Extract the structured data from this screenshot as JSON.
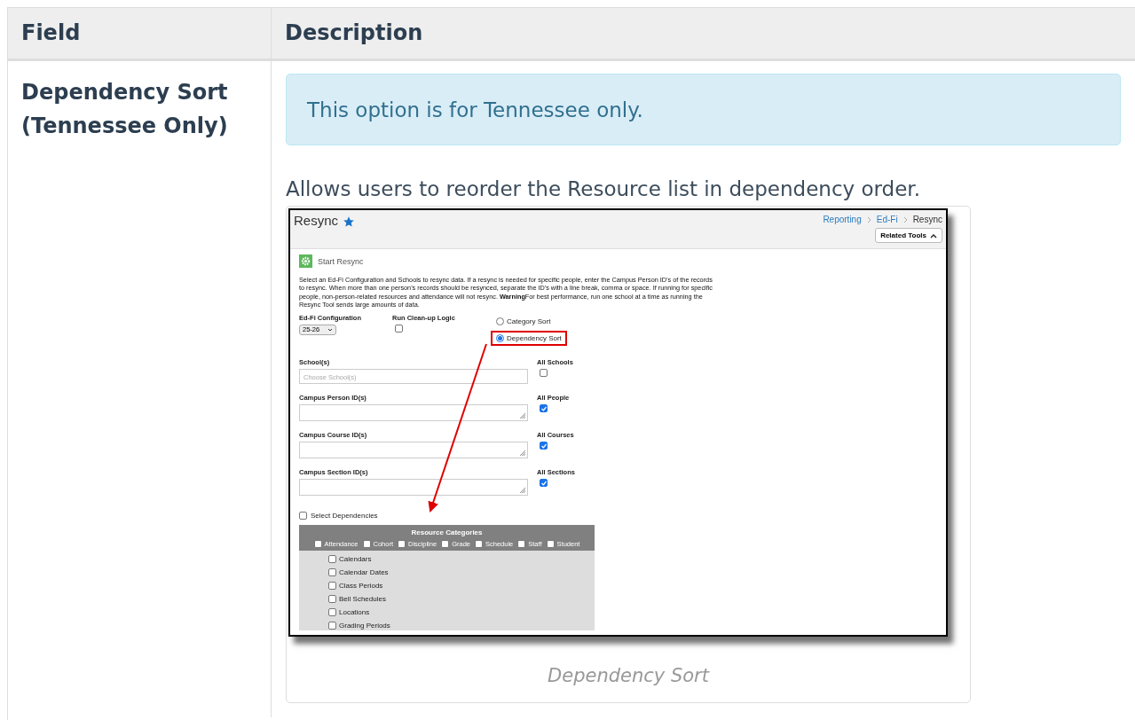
{
  "table": {
    "columns": [
      "Field",
      "Description"
    ],
    "rows": [
      {
        "field": "Dependency Sort (Tennessee Only)",
        "alert": "This option is for Tennessee only.",
        "text": "Allows users to reorder the Resource list in dependency order.",
        "figure": {
          "caption": "Dependency Sort",
          "screenshot": {
            "title": "Resync",
            "breadcrumb": [
              "Reporting",
              "Ed-Fi",
              "Resync"
            ],
            "related_tools": "Related Tools",
            "section": "Start Resync",
            "description": "Select an Ed-Fi Configuration and Schools to resync data. If a resync is needed for specific people, enter the Campus Person ID's of the records to resync. When more than one person's records should be resynced, separate the ID's with a line break, comma or space. If running for specific people, non-person-related resources and attendance will not resync. **Warning**For best performance, run one school at a time as running the Resync Tool sends large amounts of data.",
            "configuration": {
              "label": "Ed-Fi Configuration",
              "value": "25-26"
            },
            "cleanup": {
              "label": "Run Clean-up Logic",
              "checked": false
            },
            "sort_options": [
              {
                "label": "Category Sort",
                "selected": false,
                "highlighted": false
              },
              {
                "label": "Dependency Sort",
                "selected": true,
                "highlighted": true
              }
            ],
            "fields": [
              {
                "kind": "select",
                "label": "School(s)",
                "placeholder": "Choose School(s)",
                "all_label": "All Schools",
                "all_checked": false
              },
              {
                "kind": "textarea",
                "label": "Campus Person ID(s)",
                "all_label": "All People",
                "all_checked": true
              },
              {
                "kind": "textarea",
                "label": "Campus Course ID(s)",
                "all_label": "All Courses",
                "all_checked": true
              },
              {
                "kind": "textarea",
                "label": "Campus Section ID(s)",
                "all_label": "All Sections",
                "all_checked": true
              }
            ],
            "select_dependencies": {
              "label": "Select Dependencies",
              "checked": false
            },
            "resource_categories": {
              "title": "Resource Categories",
              "categories": [
                {
                  "label": "Attendance",
                  "checked": false
                },
                {
                  "label": "Cohort",
                  "checked": false
                },
                {
                  "label": "Discipline",
                  "checked": false
                },
                {
                  "label": "Grade",
                  "checked": false
                },
                {
                  "label": "Schedule",
                  "checked": false
                },
                {
                  "label": "Staff",
                  "checked": false
                },
                {
                  "label": "Student",
                  "checked": false
                }
              ],
              "resources": [
                {
                  "label": "Calendars",
                  "checked": false
                },
                {
                  "label": "Calendar Dates",
                  "checked": false
                },
                {
                  "label": "Class Periods",
                  "checked": false
                },
                {
                  "label": "Bell Schedules",
                  "checked": false
                },
                {
                  "label": "Locations",
                  "checked": false
                },
                {
                  "label": "Grading Periods",
                  "checked": false
                }
              ]
            }
          }
        }
      }
    ]
  }
}
